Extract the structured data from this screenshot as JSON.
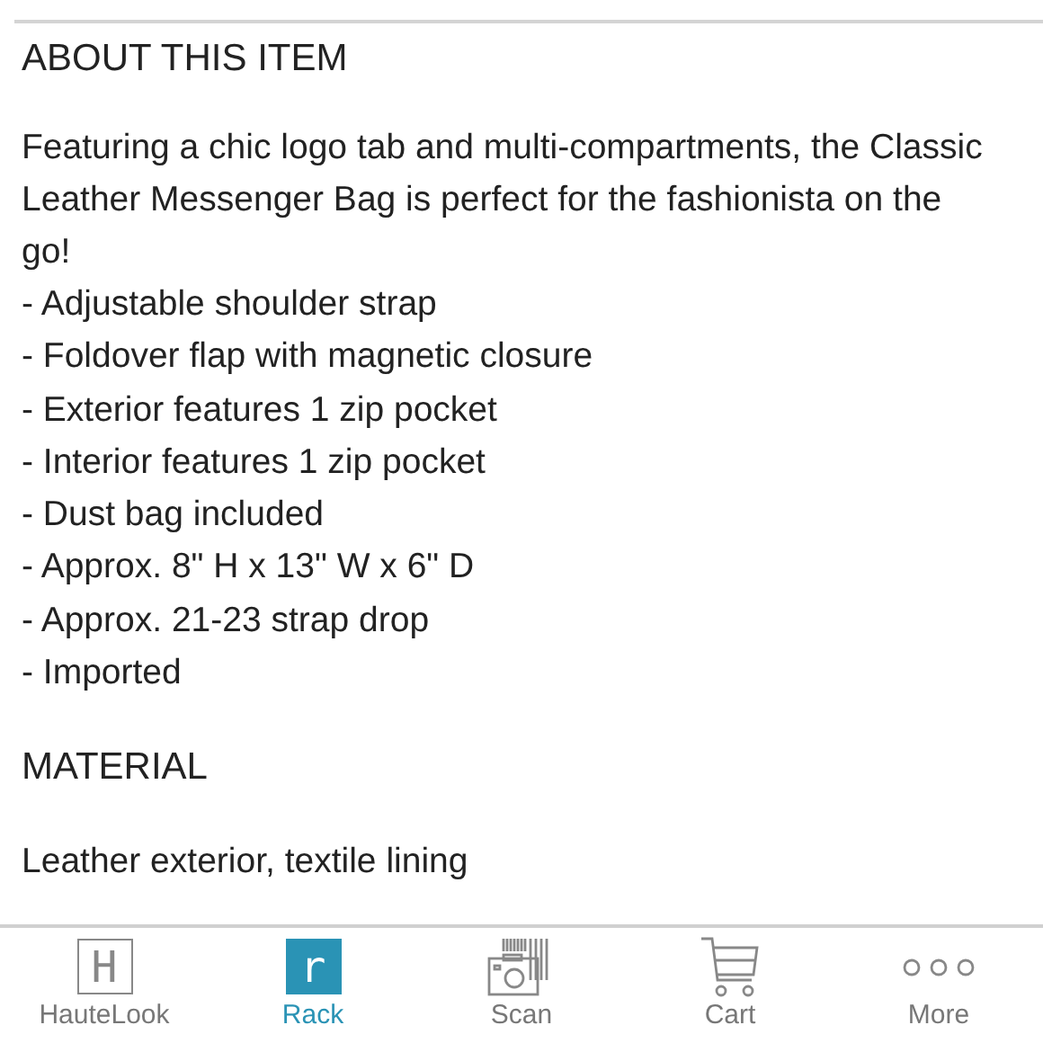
{
  "sections": [
    {
      "heading": "ABOUT THIS ITEM",
      "paragraph": "Featuring a chic logo tab and multi-compartments, the Classic Leather Messenger Bag is perfect for the fashionista on the go!",
      "list": [
        "- Adjustable shoulder strap",
        "- Foldover flap with magnetic closure",
        "- Exterior features 1 zip pocket",
        "- Interior features 1 zip pocket",
        "- Dust bag included",
        "- Approx. 8\" H x 13\" W x 6\" D",
        "- Approx. 21-23 strap drop",
        "- Imported"
      ]
    },
    {
      "heading": "MATERIAL",
      "paragraph": "Leather exterior, textile lining"
    }
  ],
  "tab_bar": [
    {
      "kind": "letter",
      "glyph": "H",
      "label": "HauteLook",
      "selected": false
    },
    {
      "kind": "letter",
      "glyph": "r",
      "label": "Rack",
      "selected": true
    },
    {
      "kind": "scan",
      "label": "Scan",
      "selected": false
    },
    {
      "kind": "cart",
      "label": "Cart",
      "selected": false
    },
    {
      "kind": "more",
      "label": "More",
      "selected": false
    }
  ]
}
